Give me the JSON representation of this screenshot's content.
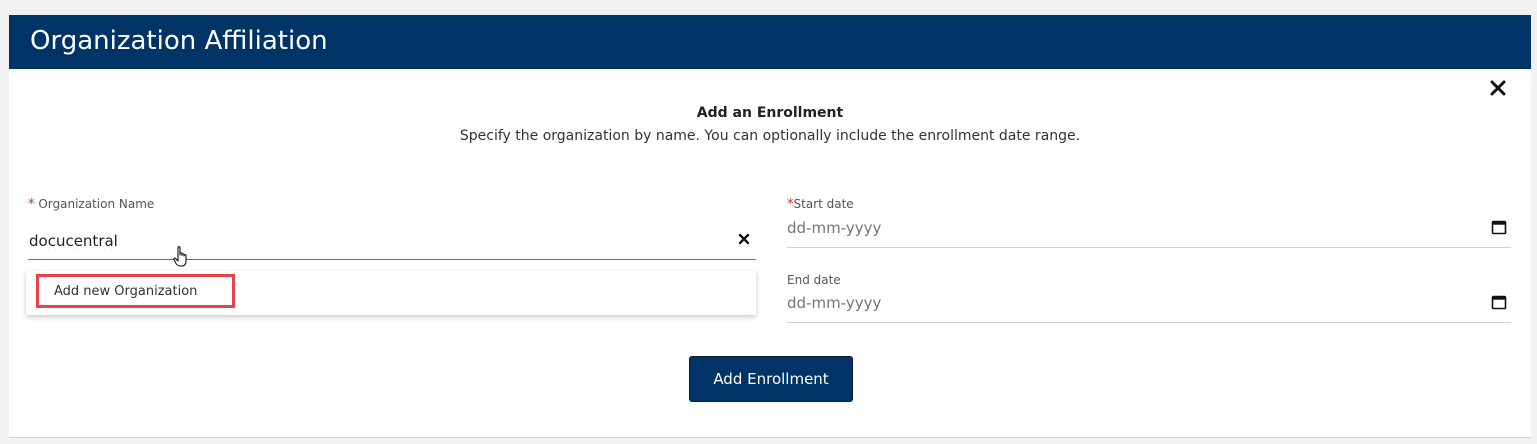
{
  "header": {
    "title": "Organization Affiliation"
  },
  "intro": {
    "heading": "Add an Enrollment",
    "description": "Specify the organization by name. You can optionally include the enrollment date range."
  },
  "form": {
    "required_mark": "*",
    "organization": {
      "label": "Organization Name",
      "value": "docucentral"
    },
    "suggestions": [
      {
        "label": "Add new Organization"
      }
    ],
    "start_date": {
      "label": "Start date",
      "placeholder": "dd-mm-yyyy"
    },
    "end_date": {
      "label": "End date",
      "placeholder": "dd-mm-yyyy"
    },
    "submit_label": "Add Enrollment"
  },
  "icons": {
    "close": "close-icon",
    "clear": "clear-icon",
    "calendar": "calendar-icon",
    "cursor": "hand-cursor-icon"
  },
  "colors": {
    "primary": "#003366",
    "focus": "#2a78d0",
    "highlight": "#e8424a",
    "required": "#d9262c",
    "background": "#f1f2f2"
  }
}
